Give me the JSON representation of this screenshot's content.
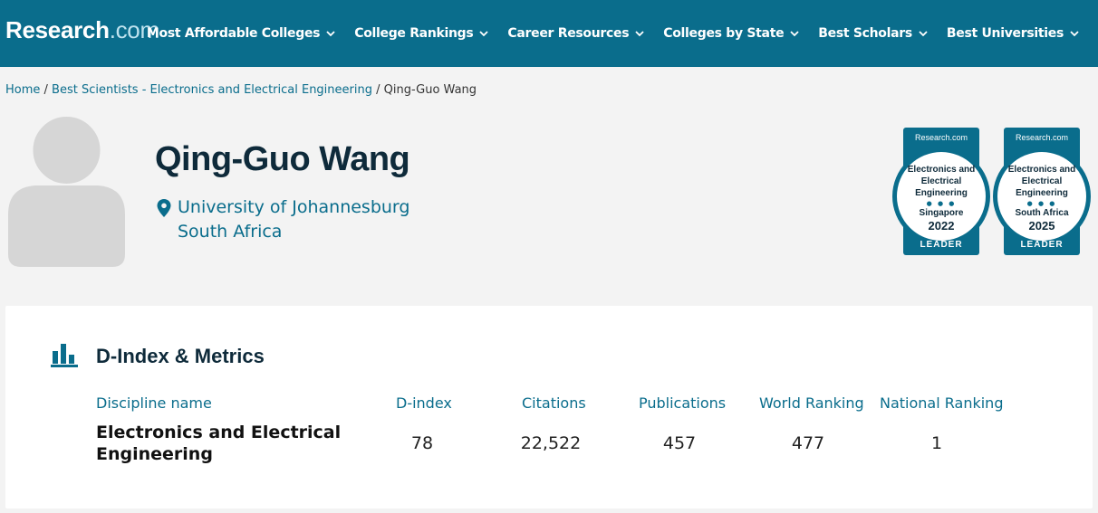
{
  "header": {
    "logo_bold": "Research",
    "logo_light": ".com",
    "nav": [
      {
        "label": "Most Affordable Colleges"
      },
      {
        "label": "College Rankings"
      },
      {
        "label": "Career Resources"
      },
      {
        "label": "Colleges by State"
      },
      {
        "label": "Best Scholars"
      },
      {
        "label": "Best Universities"
      }
    ],
    "color": "#0a6d8c"
  },
  "breadcrumb": {
    "home": "Home",
    "sep": " / ",
    "section": "Best Scientists - Electronics and Electrical Engineering",
    "current": "Qing-Guo Wang"
  },
  "profile": {
    "name": "Qing-Guo Wang",
    "institution": "University of Johannesburg",
    "country": "South Africa",
    "avatar_icon": "person-silhouette-icon",
    "location_icon": "map-pin-icon"
  },
  "badges": [
    {
      "brand": "Research.com",
      "field_line1": "Electronics and",
      "field_line2": "Electrical",
      "field_line3": "Engineering",
      "dots": "● ● ●",
      "country": "Singapore",
      "year": "2022",
      "label": "LEADER"
    },
    {
      "brand": "Research.com",
      "field_line1": "Electronics and",
      "field_line2": "Electrical",
      "field_line3": "Engineering",
      "dots": "● ● ●",
      "country": "South Africa",
      "year": "2025",
      "label": "LEADER"
    }
  ],
  "metrics": {
    "title": "D-Index & Metrics",
    "icon": "bar-chart-icon",
    "headers": {
      "discipline": "Discipline name",
      "dindex": "D-index",
      "citations": "Citations",
      "publications": "Publications",
      "world": "World Ranking",
      "national": "National Ranking"
    },
    "row": {
      "discipline_line1": "Electronics and Electrical",
      "discipline_line2": "Engineering",
      "dindex": "78",
      "citations": "22,522",
      "publications": "457",
      "world": "477",
      "national": "1"
    }
  }
}
